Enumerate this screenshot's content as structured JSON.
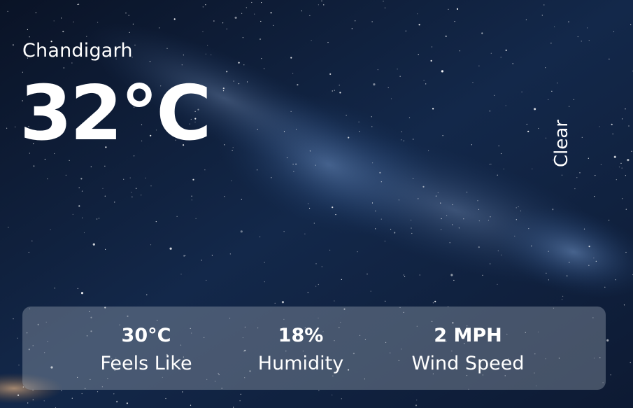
{
  "location": {
    "city": "Chandigarh"
  },
  "current": {
    "temperature": "32°C",
    "condition": "Clear"
  },
  "stats": {
    "feels_like": {
      "value": "30°C",
      "label": "Feels Like"
    },
    "humidity": {
      "value": "18%",
      "label": "Humidity"
    },
    "wind": {
      "value": "2 MPH",
      "label": "Wind Speed"
    }
  },
  "colors": {
    "sky_dark": "#0b1428",
    "sky_mid": "#1b3a66",
    "milky_way": "#5a7fb3",
    "panel": "#a0aab9",
    "text": "#ffffff"
  }
}
